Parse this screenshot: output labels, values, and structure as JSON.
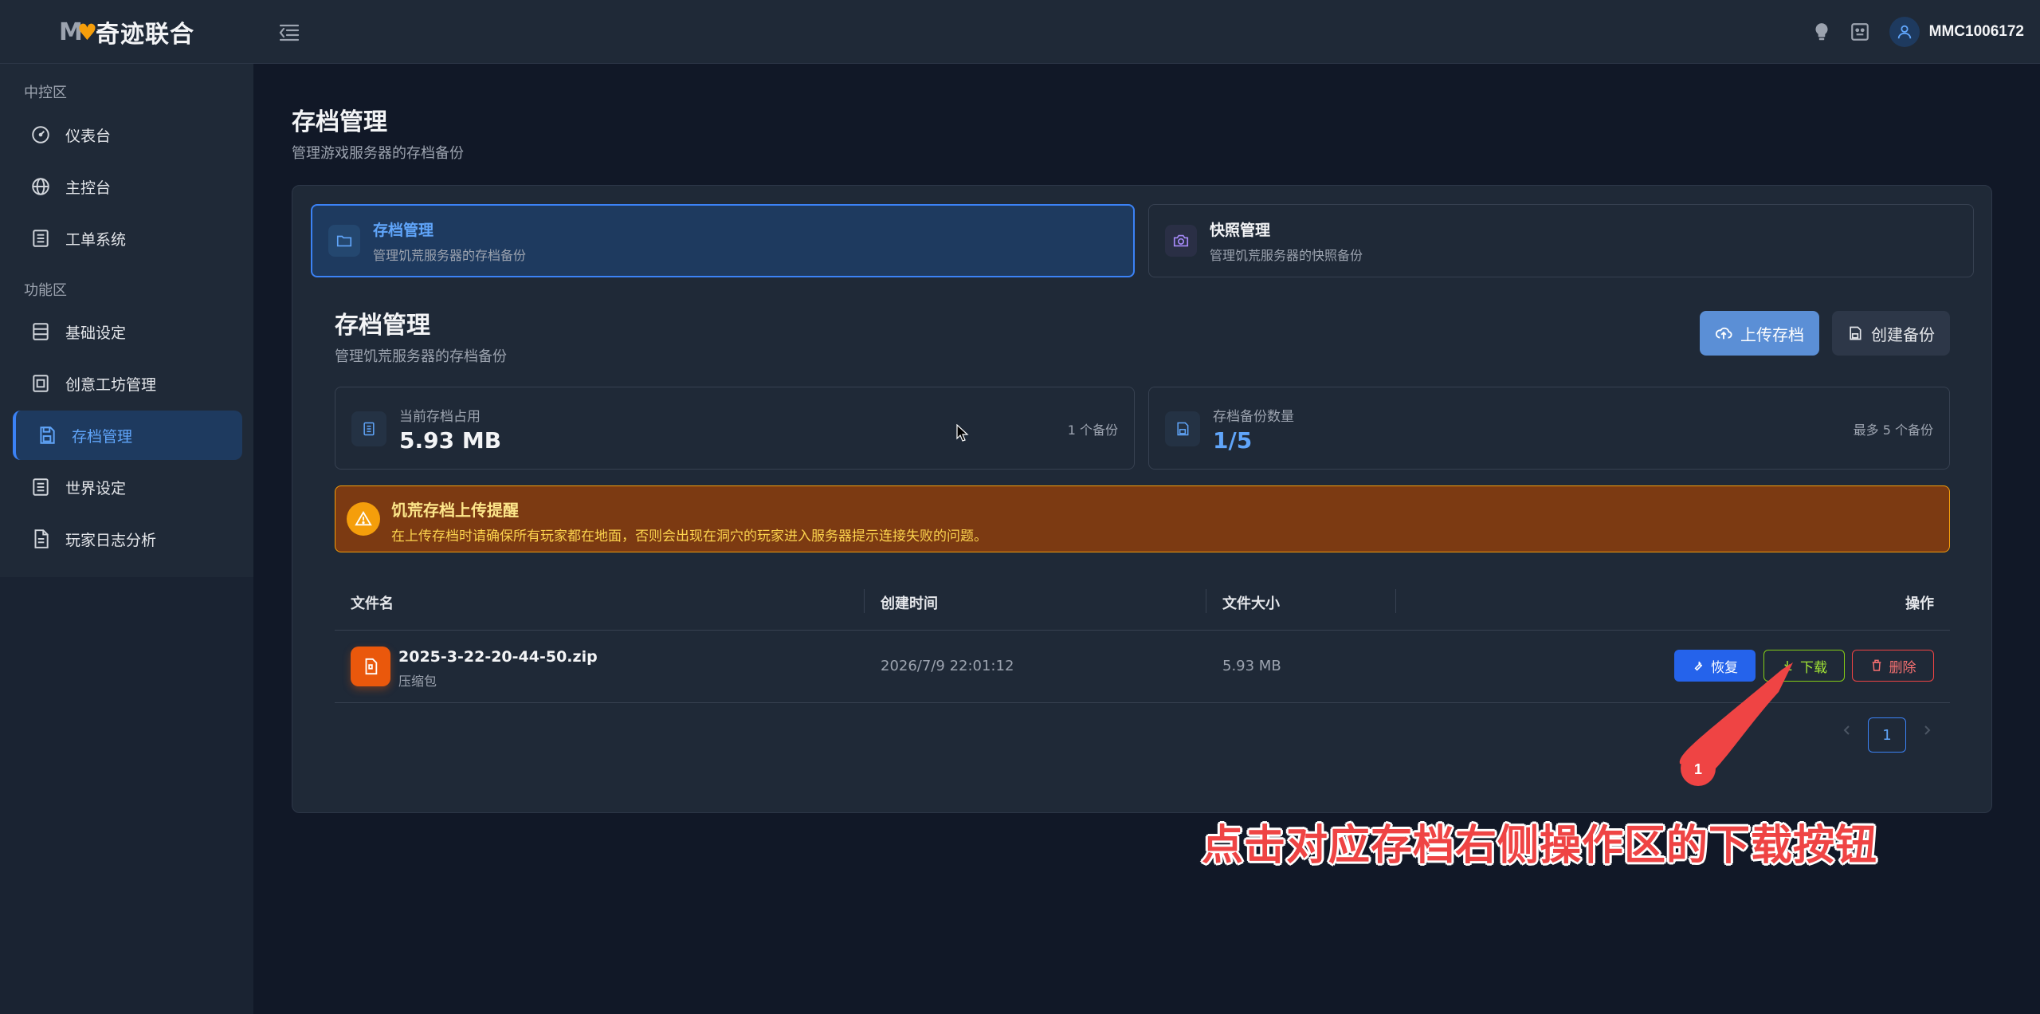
{
  "header": {
    "logo_mark": "M",
    "logo_heart": "♥",
    "logo_text": "奇迹联合",
    "username": "MMC1006172"
  },
  "sidebar": {
    "section_control": "中控区",
    "section_function": "功能区",
    "items": [
      {
        "label": "仪表台",
        "icon": "dashboard-icon"
      },
      {
        "label": "主控台",
        "icon": "globe-icon"
      },
      {
        "label": "工单系统",
        "icon": "list-icon"
      },
      {
        "label": "基础设定",
        "icon": "server-icon"
      },
      {
        "label": "创意工坊管理",
        "icon": "workshop-icon"
      },
      {
        "label": "存档管理",
        "icon": "save-icon",
        "active": true
      },
      {
        "label": "世界设定",
        "icon": "list-icon"
      },
      {
        "label": "玩家日志分析",
        "icon": "document-icon"
      }
    ]
  },
  "page": {
    "title": "存档管理",
    "subtitle": "管理游戏服务器的存档备份"
  },
  "tabs": [
    {
      "title": "存档管理",
      "desc": "管理饥荒服务器的存档备份",
      "icon": "folder-icon",
      "active": true
    },
    {
      "title": "快照管理",
      "desc": "管理饥荒服务器的快照备份",
      "icon": "camera-icon",
      "active": false
    }
  ],
  "section": {
    "title": "存档管理",
    "subtitle": "管理饥荒服务器的存档备份",
    "upload_label": "上传存档",
    "backup_label": "创建备份"
  },
  "stats": {
    "storage_label": "当前存档占用",
    "storage_value": "5.93 MB",
    "storage_aside": "1 个备份",
    "count_label": "存档备份数量",
    "count_value": "1/5",
    "count_aside": "最多 5 个备份"
  },
  "warning": {
    "title": "饥荒存档上传提醒",
    "text": "在上传存档时请确保所有玩家都在地面，否则会出现在洞穴的玩家进入服务器提示连接失败的问题。"
  },
  "table": {
    "headers": [
      "文件名",
      "创建时间",
      "文件大小",
      "操作"
    ],
    "rows": [
      {
        "name": "2025-3-22-20-44-50.zip",
        "type": "压缩包",
        "created": "2026/7/9 22:01:12",
        "size": "5.93 MB"
      }
    ],
    "actions": {
      "restore": "恢复",
      "download": "下载",
      "delete": "删除"
    }
  },
  "pagination": {
    "current": "1"
  },
  "annotation": {
    "marker": "1",
    "caption": "点击对应存档右侧操作区的下载按钮"
  },
  "colors": {
    "accent": "#3b82f6",
    "warning": "#f59e0b",
    "danger": "#ef4444",
    "success": "#84cc16"
  }
}
